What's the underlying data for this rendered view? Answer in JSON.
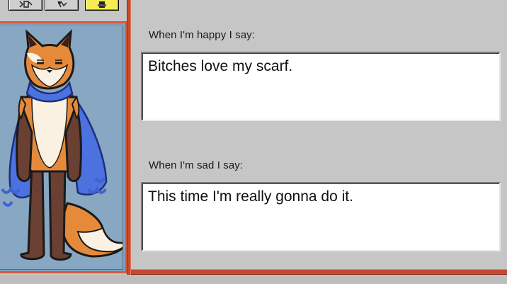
{
  "tabs": [
    {
      "name": "tab-1",
      "icon": "character-icon"
    },
    {
      "name": "tab-2",
      "icon": "character-icon"
    },
    {
      "name": "tab-3",
      "icon": "character-icon",
      "active": true
    }
  ],
  "character": {
    "portrait": "fox-character"
  },
  "dialog": {
    "happy_label": "When I'm happy I say:",
    "happy_text": "Bitches love my scarf.",
    "sad_label": "When I'm sad I say:",
    "sad_text": "This time I'm really gonna do it."
  },
  "colors": {
    "frame_accent": "#d9583f",
    "portrait_bg": "#88a7c2",
    "active_tab": "#f4ec52",
    "window_bg": "#c6c6c6"
  }
}
